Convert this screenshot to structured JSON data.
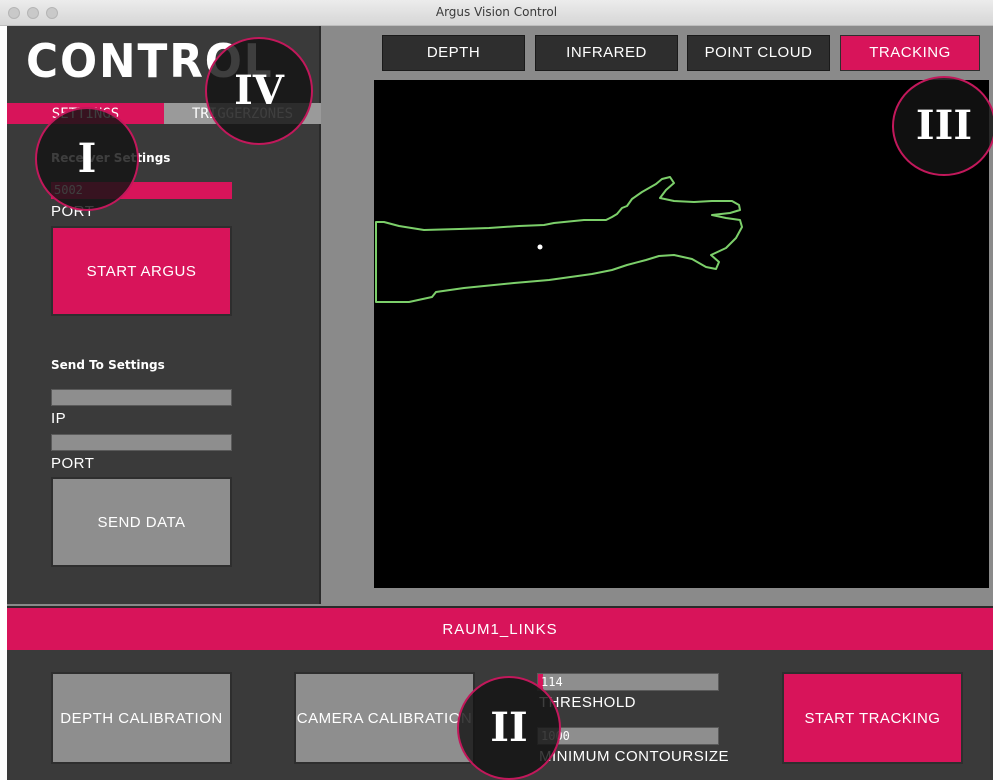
{
  "window": {
    "title": "Argus Vision Control"
  },
  "logo": "CONTROL",
  "tabs": [
    {
      "label": "SETTINGS"
    },
    {
      "label": "TRIGGERZONES"
    }
  ],
  "receiver": {
    "heading": "Receiver Settings",
    "port_value": "5002",
    "port_label": "PORT",
    "start_label": "START ARGUS"
  },
  "sendto": {
    "heading": "Send To Settings",
    "ip_value": "",
    "ip_label": "IP",
    "port_value": "",
    "port_label": "PORT",
    "send_label": "SEND DATA"
  },
  "view_buttons": [
    {
      "label": "DEPTH",
      "active": false
    },
    {
      "label": "INFRARED",
      "active": false
    },
    {
      "label": "POINT CLOUD",
      "active": false
    },
    {
      "label": "TRACKING",
      "active": true
    }
  ],
  "scene_name": "RAUM1_LINKS",
  "bottom": {
    "depth_calibration": "DEPTH CALIBRATION",
    "camera_calibration": "CAMERA CALIBRATION",
    "threshold_value": "114",
    "threshold_label": "THRESHOLD",
    "threshold_level": 0.03,
    "contour_value": "1000",
    "contour_label": "MINIMUM CONTOURSIZE",
    "start_tracking": "START TRACKING"
  },
  "annotations": [
    "I",
    "II",
    "III",
    "IV"
  ],
  "colors": {
    "accent": "#d8145a",
    "panel": "#3a3a3a",
    "contour": "#7ccf6a"
  }
}
